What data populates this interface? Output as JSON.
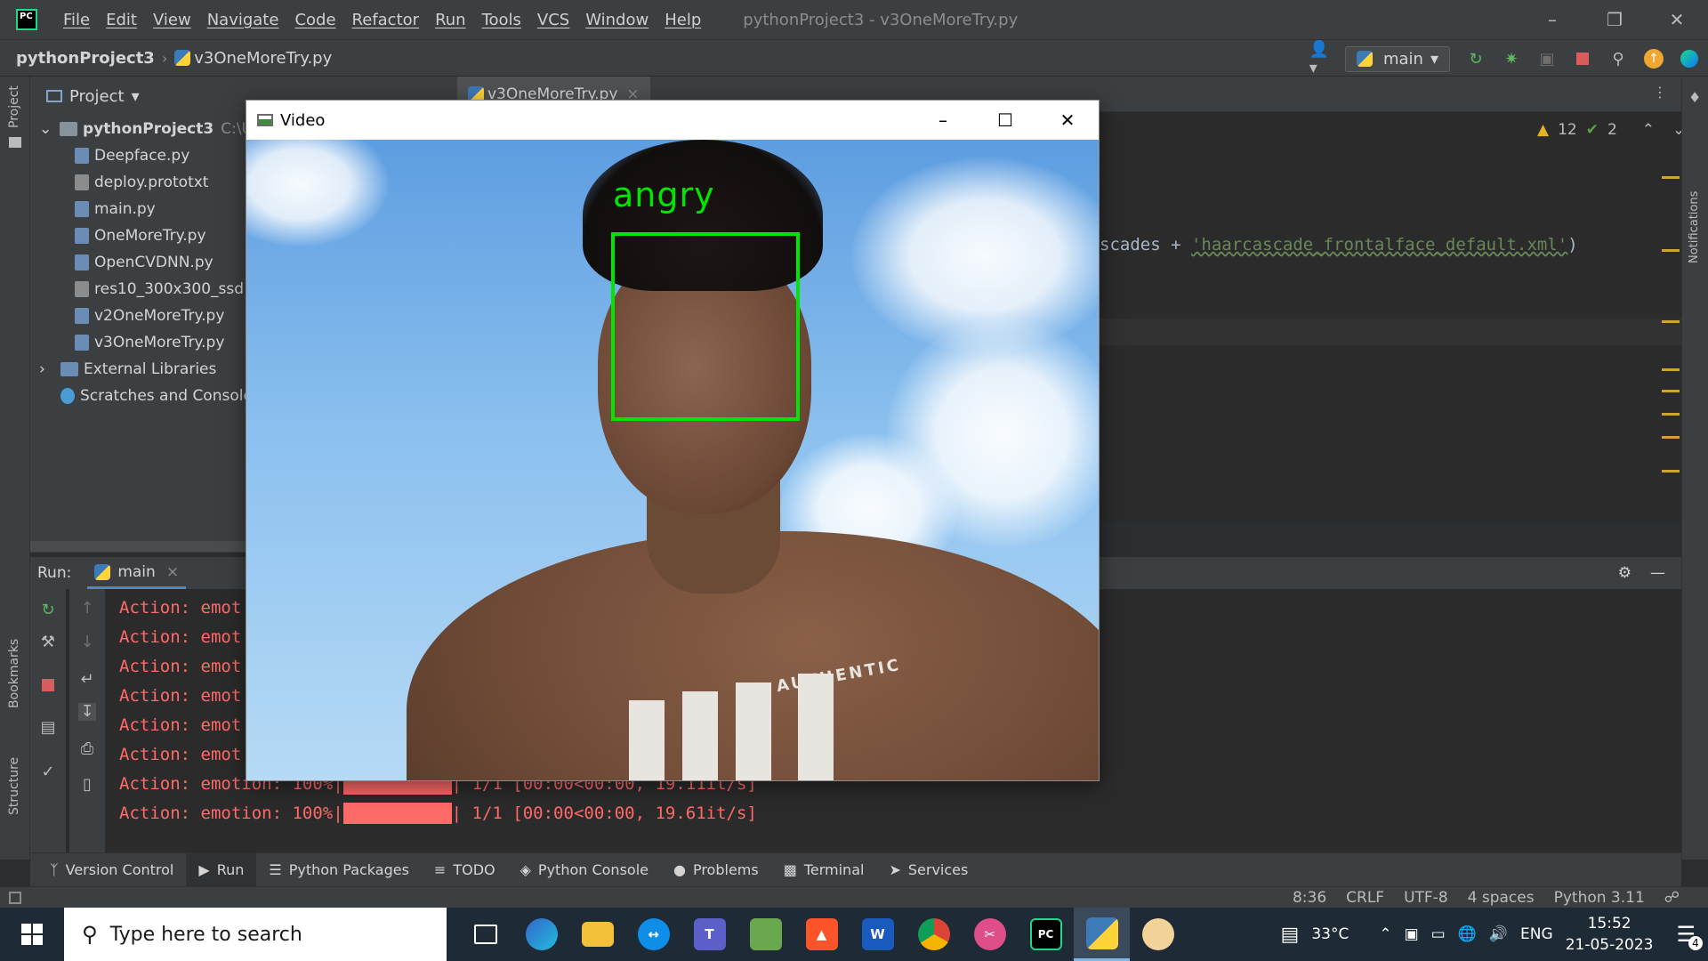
{
  "app": {
    "logo_text": "PC",
    "window_title": "pythonProject3 - v3OneMoreTry.py",
    "menu": [
      "File",
      "Edit",
      "View",
      "Navigate",
      "Code",
      "Refactor",
      "Run",
      "Tools",
      "VCS",
      "Window",
      "Help"
    ]
  },
  "navbar": {
    "project": "pythonProject3",
    "file": "v3OneMoreTry.py",
    "run_config": "main"
  },
  "left_stripe": {
    "project": "Project",
    "bookmarks": "Bookmarks",
    "structure": "Structure"
  },
  "right_stripe": {
    "notifications": "Notifications"
  },
  "project_panel": {
    "title": "Project",
    "root": "pythonProject3",
    "root_path": "C:\\U",
    "files": [
      "Deepface.py",
      "deploy.prototxt",
      "main.py",
      "OneMoreTry.py",
      "OpenCVDNN.py",
      "res10_300x300_ssd",
      "v2OneMoreTry.py",
      "v3OneMoreTry.py"
    ],
    "external_libraries": "External Libraries",
    "scratches": "Scratches and Console"
  },
  "editor": {
    "tab": "v3OneMoreTry.py",
    "code_prefix": "scades + ",
    "code_string": "'haarcascade_frontalface_default.xml'",
    "code_suffix": ")",
    "warnings": "12",
    "ok_count": "2"
  },
  "run_panel": {
    "label": "Run:",
    "tab": "main",
    "lines": [
      "Action: emot",
      "Action: emot",
      "Action: emot",
      "Action: emot",
      "Action: emot",
      "Action: emot"
    ],
    "partial_line": {
      "prefix": "Action: emotion: 100%|",
      "suffix": "| 1/1 [00:00<00:00, 19.11it/s]"
    },
    "last_line": {
      "prefix": "Action: emotion: 100%|",
      "suffix": "| 1/1 [00:00<00:00, 19.61it/s]"
    }
  },
  "tool_tabs": [
    "Version Control",
    "Run",
    "Python Packages",
    "TODO",
    "Python Console",
    "Problems",
    "Terminal",
    "Services"
  ],
  "status_bar": {
    "position": "8:36",
    "line_sep": "CRLF",
    "encoding": "UTF-8",
    "indent": "4 spaces",
    "interpreter": "Python 3.11"
  },
  "video_window": {
    "title": "Video",
    "emotion": "angry",
    "shirt_text": "AUTHENTIC",
    "box_color": "#00e600"
  },
  "taskbar": {
    "search_placeholder": "Type here to search",
    "temperature": "33°C",
    "language": "ENG",
    "time": "15:52",
    "date": "21-05-2023",
    "notification_count": "4",
    "apps": [
      "task-view",
      "edge",
      "file-explorer",
      "teamviewer",
      "teams",
      "notepad",
      "brave",
      "word",
      "chrome",
      "snipping-tool",
      "pycharm",
      "python",
      "paint"
    ]
  },
  "colors": {
    "ide_bg": "#2b2b2b",
    "panel_bg": "#3c3f41",
    "console_error": "#ff6b68",
    "face_box": "#00e600"
  }
}
